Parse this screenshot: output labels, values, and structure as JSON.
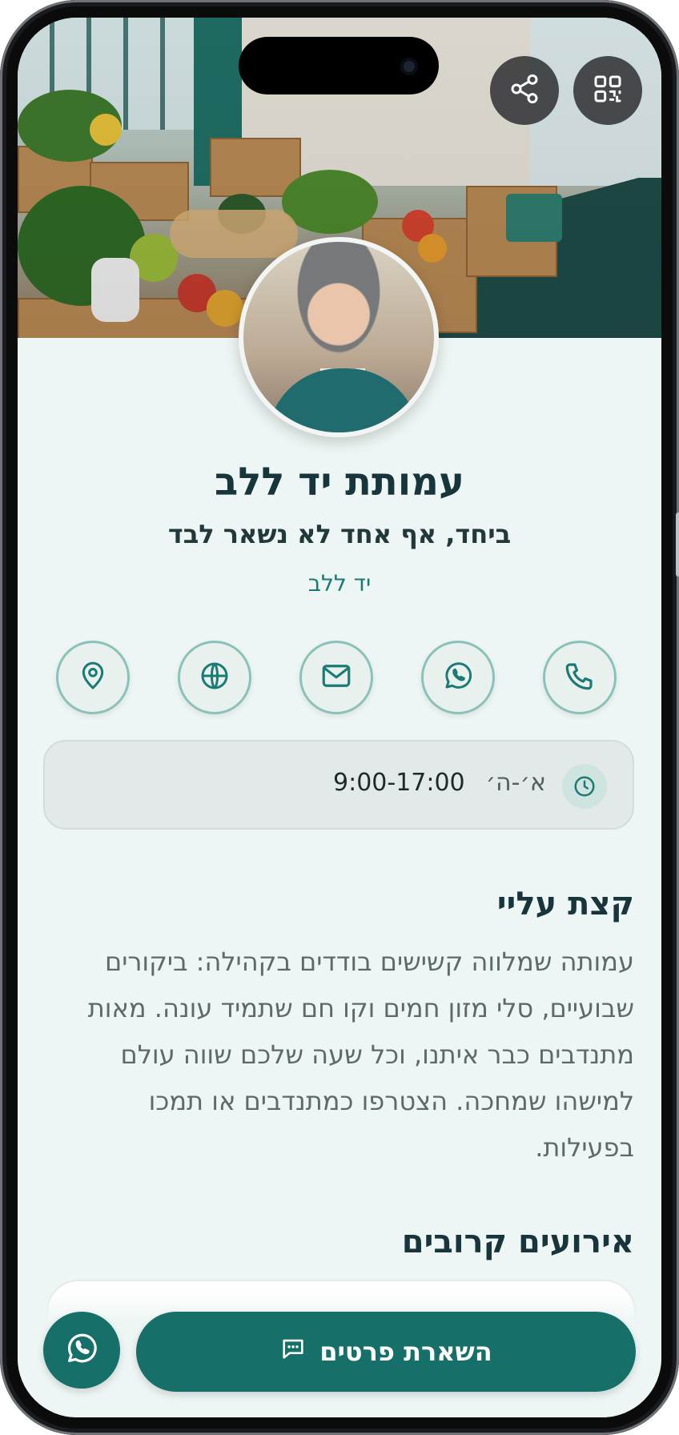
{
  "profile": {
    "name": "עמותת יד ללב",
    "tagline": "ביחד, אף אחד לא נשאר לבד",
    "org_name": "יד ללב"
  },
  "header": {
    "share_icon": "share-icon",
    "qr_icon": "qr-code-icon"
  },
  "actions": [
    {
      "icon": "map-pin-icon"
    },
    {
      "icon": "globe-icon"
    },
    {
      "icon": "mail-icon"
    },
    {
      "icon": "whatsapp-icon"
    },
    {
      "icon": "phone-icon"
    }
  ],
  "hours": {
    "days": "א׳-ה׳",
    "time": "9:00-17:00"
  },
  "about": {
    "title": "קצת עליי",
    "text": "עמותה שמלווה קשישים בודדים בקהילה: ביקורים שבועיים, סלי מזון חמים וקו חם שתמיד עונה. מאות מתנדבים כבר איתנו, וכל שעה שלכם שווה עולם למישהו שמחכה. הצטרפו כמתנדבים או תמכו בפעילות."
  },
  "events": {
    "title": "אירועים קרובים"
  },
  "bottom": {
    "cta_label": "השארת פרטים"
  },
  "colors": {
    "brand": "#176f69",
    "background": "#edf6f4",
    "heading": "#17353a"
  }
}
